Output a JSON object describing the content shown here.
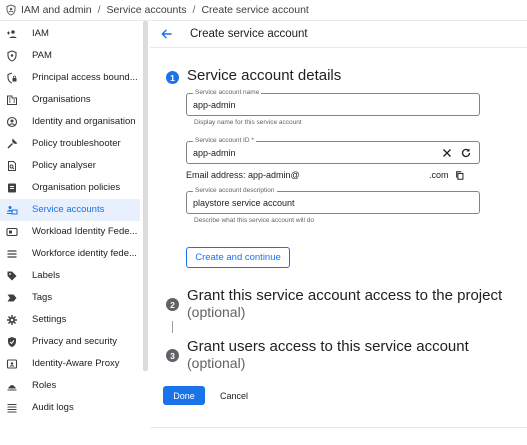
{
  "breadcrumb": {
    "items": [
      "IAM and admin",
      "Service accounts",
      "Create service account"
    ],
    "separator": "/"
  },
  "sidebar": {
    "items": [
      {
        "label": "IAM",
        "icon": "person-add-icon"
      },
      {
        "label": "PAM",
        "icon": "shield-icon"
      },
      {
        "label": "Principal access bound...",
        "icon": "shield-lock-icon"
      },
      {
        "label": "Organisations",
        "icon": "business-icon"
      },
      {
        "label": "Identity and organisation",
        "icon": "account-circle-icon"
      },
      {
        "label": "Policy troubleshooter",
        "icon": "wrench-icon"
      },
      {
        "label": "Policy analyser",
        "icon": "document-search-icon"
      },
      {
        "label": "Organisation policies",
        "icon": "document-icon"
      },
      {
        "label": "Service accounts",
        "icon": "service-account-icon",
        "active": true
      },
      {
        "label": "Workload Identity Fede...",
        "icon": "card-icon"
      },
      {
        "label": "Workforce identity fede...",
        "icon": "list-icon"
      },
      {
        "label": "Labels",
        "icon": "tag-icon"
      },
      {
        "label": "Tags",
        "icon": "label-arrow-icon"
      },
      {
        "label": "Settings",
        "icon": "gear-icon"
      },
      {
        "label": "Privacy and security",
        "icon": "shield-check-icon"
      },
      {
        "label": "Identity-Aware Proxy",
        "icon": "badge-icon"
      },
      {
        "label": "Roles",
        "icon": "roles-icon"
      },
      {
        "label": "Audit logs",
        "icon": "list-lines-icon"
      }
    ]
  },
  "header": {
    "title": "Create service account"
  },
  "steps": [
    {
      "number": "1",
      "title": "Service account details",
      "subtitle": ""
    },
    {
      "number": "2",
      "title": "Grant this service account access to the project",
      "subtitle": "(optional)"
    },
    {
      "number": "3",
      "title": "Grant users access to this service account",
      "subtitle": "(optional)"
    }
  ],
  "form": {
    "name": {
      "label": "Service account name",
      "value": "app-admin",
      "hint": "Display name for this service account"
    },
    "id": {
      "label": "Service account ID *",
      "value": "app-admin"
    },
    "email": {
      "prefix": "Email address: app-admin@",
      "suffix": ".com"
    },
    "description": {
      "label": "Service account description",
      "value": "playstore service account",
      "hint": "Describe what this service account will do"
    },
    "continue_label": "Create and continue"
  },
  "footer": {
    "done_label": "Done",
    "cancel_label": "Cancel"
  },
  "colors": {
    "accent": "#1a73e8",
    "active_bg": "#e8f0fe",
    "text": "#202124",
    "muted": "#5f6368"
  }
}
